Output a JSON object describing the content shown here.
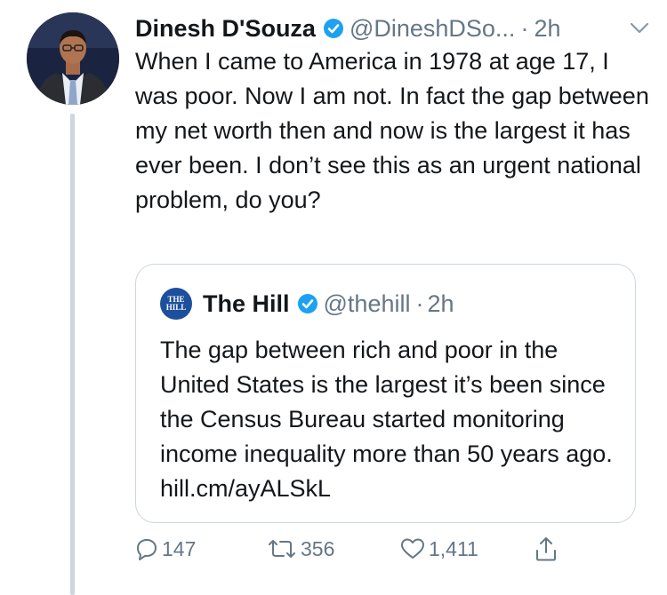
{
  "tweet": {
    "display_name": "Dinesh D'Souza",
    "handle": "@DineshDSo...",
    "separator": "·",
    "time": "2h",
    "text": "When I came to America in 1978 at age 17, I was poor. Now I am not. In fact the gap between my net worth then and now is the largest it has ever been. I don’t see this as an urgent national problem, do you?"
  },
  "quote": {
    "avatar_text_line1": "THE",
    "avatar_text_line2": "HILL",
    "display_name": "The Hill",
    "handle": "@thehill",
    "separator": "·",
    "time": "2h",
    "text": "The gap between rich and poor in the United States is the largest it’s been since the Census Bureau started monitoring income inequality more than 50 years ago. hill.cm/ayALSkL"
  },
  "actions": {
    "reply_count": "147",
    "retweet_count": "356",
    "like_count": "1,411"
  },
  "icons": {
    "verified": "verified-badge-icon",
    "caret": "chevron-down-icon",
    "reply": "reply-icon",
    "retweet": "retweet-icon",
    "like": "heart-icon",
    "share": "share-icon"
  },
  "colors": {
    "verified_blue": "#1da1f2",
    "secondary_text": "#657786",
    "border": "#ccd6dd",
    "hill_blue": "#1c4f9c"
  }
}
